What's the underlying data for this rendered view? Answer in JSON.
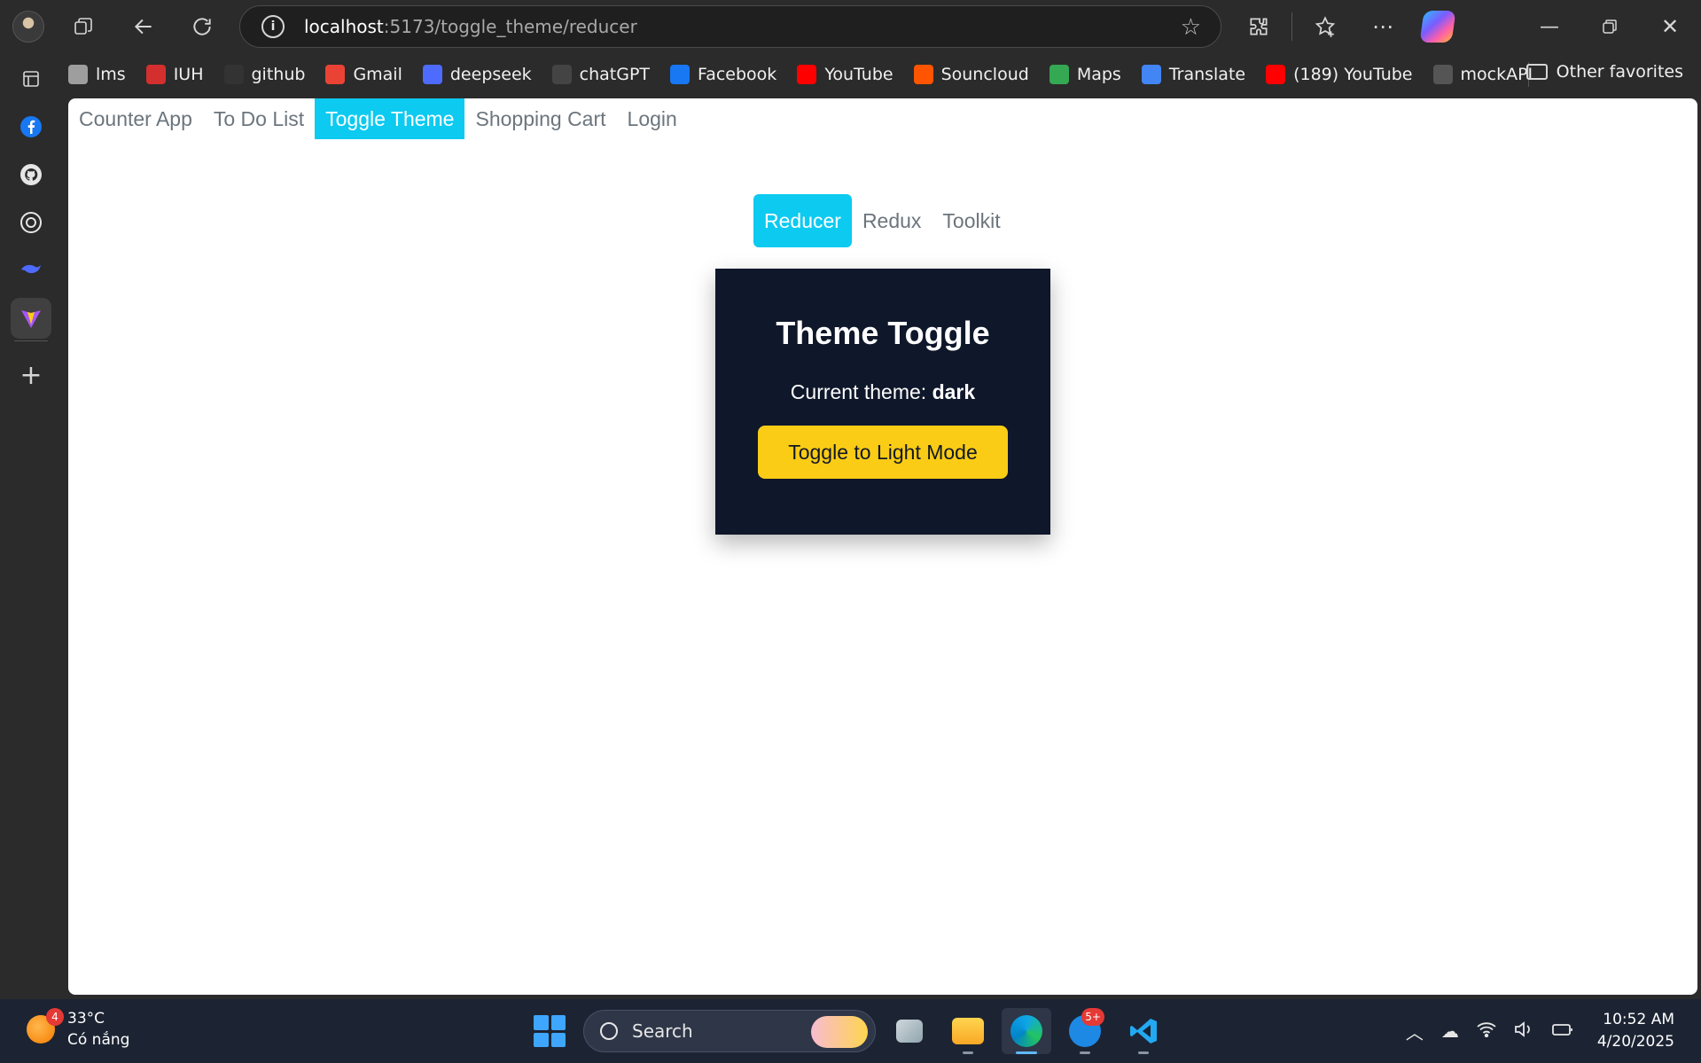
{
  "browser": {
    "address": {
      "host": "localhost",
      "path": ":5173/toggle_theme/reducer"
    },
    "bookmarks": [
      {
        "label": "lms",
        "icon": "lms-icon",
        "color": "#9e9e9e"
      },
      {
        "label": "IUH",
        "icon": "iuh-icon",
        "color": "#d32f2f"
      },
      {
        "label": "github",
        "icon": "github-icon",
        "color": "#333333"
      },
      {
        "label": "Gmail",
        "icon": "gmail-icon",
        "color": "#ea4335"
      },
      {
        "label": "deepseek",
        "icon": "deepseek-icon",
        "color": "#4d6bfe"
      },
      {
        "label": "chatGPT",
        "icon": "chatgpt-icon",
        "color": "#444444"
      },
      {
        "label": "Facebook",
        "icon": "facebook-icon",
        "color": "#1877f2"
      },
      {
        "label": "YouTube",
        "icon": "youtube-icon",
        "color": "#ff0000"
      },
      {
        "label": "Souncloud",
        "icon": "soundcloud-icon",
        "color": "#ff5500"
      },
      {
        "label": "Maps",
        "icon": "maps-icon",
        "color": "#34a853"
      },
      {
        "label": "Translate",
        "icon": "translate-icon",
        "color": "#4285f4"
      },
      {
        "label": "(189) YouTube",
        "icon": "youtube-icon",
        "color": "#ff0000"
      },
      {
        "label": "mockAPI",
        "icon": "mockapi-icon",
        "color": "#555555"
      }
    ],
    "other_favorites": "Other favorites"
  },
  "app": {
    "nav": [
      {
        "label": "Counter App",
        "active": false
      },
      {
        "label": "To Do List",
        "active": false
      },
      {
        "label": "Toggle Theme",
        "active": true
      },
      {
        "label": "Shopping Cart",
        "active": false
      },
      {
        "label": "Login",
        "active": false
      }
    ],
    "subtabs": [
      {
        "label": "Reducer",
        "active": true
      },
      {
        "label": "Redux",
        "active": false
      },
      {
        "label": "Toolkit",
        "active": false
      }
    ],
    "card": {
      "title": "Theme Toggle",
      "theme_label": "Current theme:",
      "theme_value": "dark",
      "button_label": "Toggle to Light Mode"
    },
    "colors": {
      "accent": "#0dcaf0",
      "card_bg": "#0f172a",
      "button": "#facc15"
    }
  },
  "taskbar": {
    "weather": {
      "temp": "33°C",
      "condition": "Có nắng",
      "badge": "4"
    },
    "search_placeholder": "Search",
    "zalo_badge": "5+",
    "time": "10:52 AM",
    "date": "4/20/2025"
  }
}
